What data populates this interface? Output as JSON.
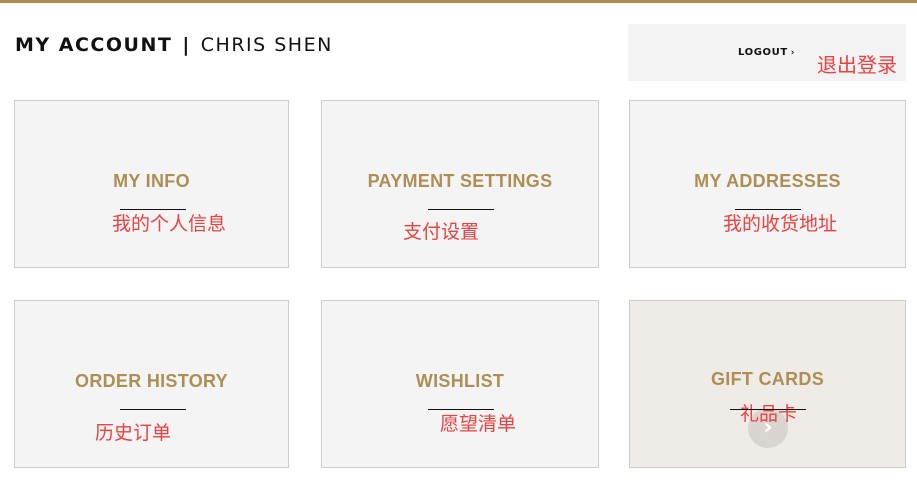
{
  "header": {
    "title": "MY ACCOUNT",
    "separator": "|",
    "user_name": "CHRIS SHEN",
    "logout_label": "LOGOUT",
    "logout_chevron": "›",
    "logout_annotation": "退出登录"
  },
  "cards": [
    {
      "title": "MY INFO",
      "annotation": "我的个人信息"
    },
    {
      "title": "PAYMENT SETTINGS",
      "annotation": "支付设置"
    },
    {
      "title": "MY ADDRESSES",
      "annotation": "我的收货地址"
    },
    {
      "title": "ORDER HISTORY",
      "annotation": "历史订单"
    },
    {
      "title": "WISHLIST",
      "annotation": "愿望清单"
    },
    {
      "title": "GIFT CARDS",
      "annotation": "礼品卡",
      "hover_icon": "chevron-right-icon",
      "hover_glyph": "›"
    }
  ],
  "colors": {
    "accent_gold": "#ad8f55",
    "top_bar": "#b08d4f",
    "annotation_red": "#ee4040",
    "card_bg": "#f4f4f4",
    "card_bg_hover": "#efebe6"
  }
}
